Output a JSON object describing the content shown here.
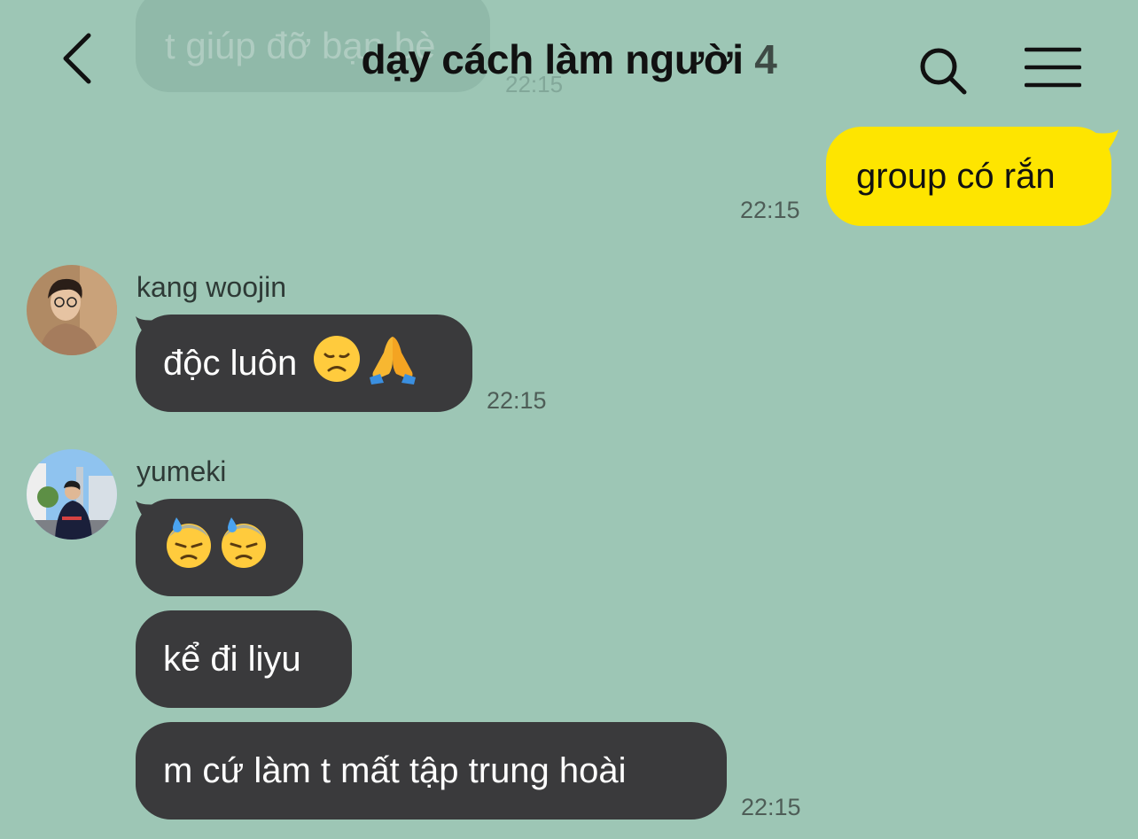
{
  "header": {
    "title": "dạy cách làm người",
    "member_count": "4"
  },
  "faded_message": {
    "text": "t giúp đỡ bạn bè",
    "time": "22:15"
  },
  "messages": [
    {
      "sender": "me",
      "text": "group có rắn",
      "time": "22:15"
    },
    {
      "sender": "kang woojin",
      "text": "độc luôn",
      "emojis": [
        "disappointed-face",
        "folded-hands"
      ],
      "time": "22:15"
    },
    {
      "sender": "yumeki",
      "emojis": [
        "downcast-face-with-sweat",
        "downcast-face-with-sweat"
      ]
    },
    {
      "sender": "yumeki",
      "text": "kể đi liyu"
    },
    {
      "sender": "yumeki",
      "text": "m cứ làm t mất tập trung hoài",
      "time": "22:15"
    }
  ],
  "colors": {
    "background": "#9dc6b5",
    "incoming_bubble": "#3a3a3c",
    "outgoing_bubble": "#fee500"
  }
}
